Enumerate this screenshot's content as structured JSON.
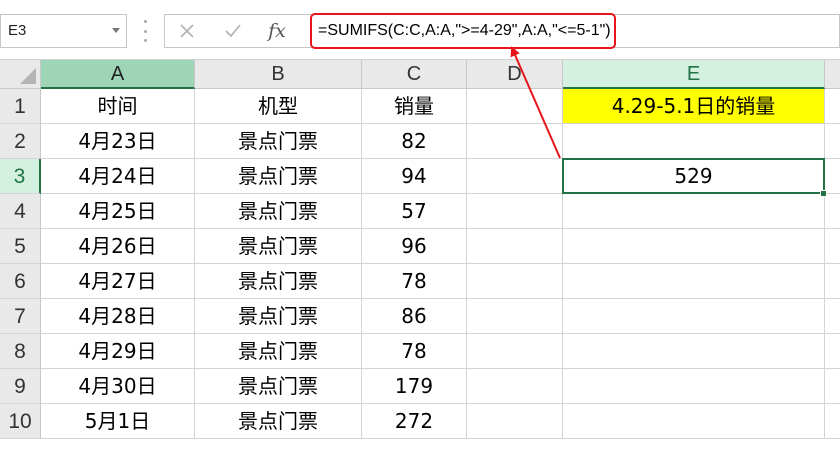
{
  "formula_bar": {
    "name_box": "E3",
    "cancel_icon": "close-icon",
    "confirm_icon": "check-icon",
    "fx_label": "fx",
    "formula": "=SUMIFS(C:C,A:A,\">=4-29\",A:A,\"<=5-1\")"
  },
  "sheet": {
    "columns": [
      "A",
      "B",
      "C",
      "D",
      "E"
    ],
    "rows": [
      "1",
      "2",
      "3",
      "4",
      "5",
      "6",
      "7",
      "8",
      "9",
      "10"
    ],
    "cells": [
      [
        "时间",
        "机型",
        "销量",
        "",
        "4.29-5.1日的销量"
      ],
      [
        "4月23日",
        "景点门票",
        "82",
        "",
        ""
      ],
      [
        "4月24日",
        "景点门票",
        "94",
        "",
        "529"
      ],
      [
        "4月25日",
        "景点门票",
        "57",
        "",
        ""
      ],
      [
        "4月26日",
        "景点门票",
        "96",
        "",
        ""
      ],
      [
        "4月27日",
        "景点门票",
        "78",
        "",
        ""
      ],
      [
        "4月28日",
        "景点门票",
        "86",
        "",
        ""
      ],
      [
        "4月29日",
        "景点门票",
        "78",
        "",
        ""
      ],
      [
        "4月30日",
        "景点门票",
        "179",
        "",
        ""
      ],
      [
        "5月1日",
        "景点门票",
        "272",
        "",
        ""
      ]
    ],
    "active_cell": "E3",
    "highlight_color": "#ffff00",
    "selection_color": "#217346",
    "annotation_color": "#e8151b"
  }
}
